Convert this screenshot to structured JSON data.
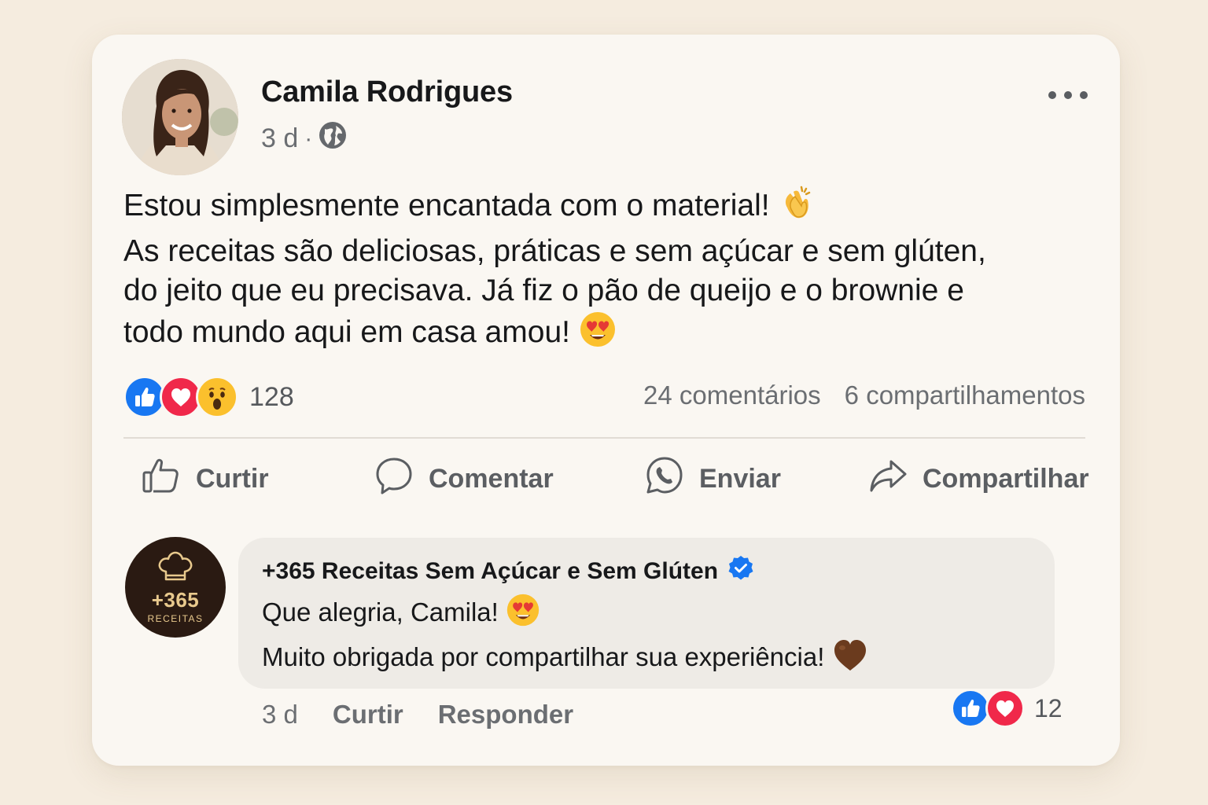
{
  "post": {
    "author": "Camila Rodrigues",
    "time": "3 d",
    "separator": "·",
    "audience_icon": "globe-icon",
    "lines": [
      "Estou simplesmente encantada com o material!",
      "As receitas são deliciosas, práticas e sem açúcar e sem glúten,",
      "do jeito que eu precisava. Já fiz o pão de queijo e o brownie e",
      "todo mundo aqui em casa amou!"
    ],
    "reactions_count": "128",
    "comments_count": "24 comentários",
    "shares_count": "6 compartilhamentos"
  },
  "actions": {
    "like": "Curtir",
    "comment": "Comentar",
    "send": "Enviar",
    "share": "Compartilhar"
  },
  "comment": {
    "avatar_number": "+365",
    "avatar_sub": "RECEITAS",
    "author": "+365 Receitas Sem Açúcar e Sem Glúten",
    "lines": [
      "Que alegria, Camila!",
      "Muito obrigada por compartilhar sua experiência!"
    ],
    "time": "3 d",
    "like": "Curtir",
    "reply": "Responder",
    "reactions_count": "12"
  },
  "colors": {
    "like_blue": "#1877f2",
    "love_red": "#f0284a",
    "verified_blue": "#1877f2"
  }
}
